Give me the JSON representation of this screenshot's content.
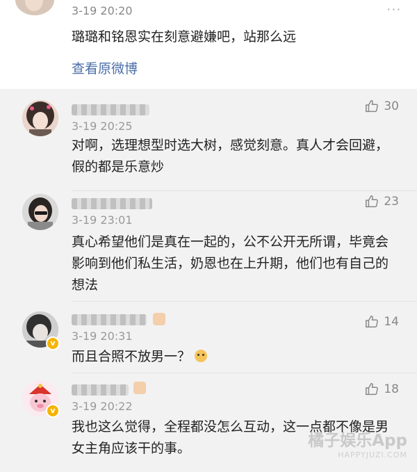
{
  "top_post": {
    "time": "3-19 20:20",
    "text": "璐璐和铭恩实在刻意避嫌吧，站那么远",
    "link": "查看原微博",
    "more": "···"
  },
  "comments": [
    {
      "time": "3-19 20:25",
      "text": "对啊，选理想型时选大树，感觉刻意。真人才会回避，假的都是乐意炒",
      "likes": "30",
      "verified": false
    },
    {
      "time": "3-19 23:01",
      "text": "真心希望他们是真在一起的，公不公开无所谓，毕竟会影响到他们私生活，奶恩也在上升期，他们也有自己的想法",
      "likes": "23",
      "verified": false
    },
    {
      "time": "3-19 20:31",
      "text": "而且合照不放男一？",
      "likes": "14",
      "verified": true
    },
    {
      "time": "3-19 20:22",
      "text": "我也这么觉得，全程都没怎么互动，这一点都不像是男女主角应该干的事。",
      "likes": "18",
      "verified": true
    }
  ],
  "watermark": {
    "main": "橘子娱乐App",
    "sub": "HAPPYJUZI.COM"
  },
  "icons": {
    "like": "thumbs-up-icon",
    "verified": "v-badge-icon",
    "emoji": "doge-emoji-icon"
  },
  "colors": {
    "link": "#4a6ea8",
    "verified_badge": "#f5b400"
  }
}
